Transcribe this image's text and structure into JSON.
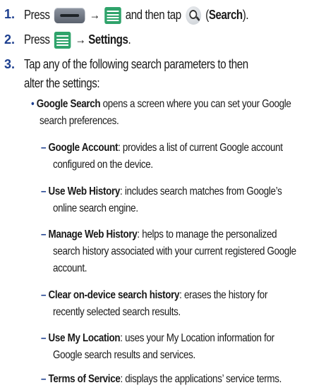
{
  "steps": [
    {
      "number": "1.",
      "press": "Press",
      "arrow": "→",
      "and_then_tap": "and then tap",
      "open_paren": "(",
      "search_label": "Search",
      "close_paren": ")."
    },
    {
      "number": "2.",
      "press": "Press",
      "arrow": "→",
      "settings_label": "Settings",
      "period": "."
    },
    {
      "number": "3.",
      "line1": "Tap any of the following search parameters to then",
      "line2": "alter the settings:"
    }
  ],
  "bullet": {
    "marker": "•",
    "term": "Google Search",
    "line1": "opens a screen where you can set your Google",
    "line2": "search preferences."
  },
  "items": [
    {
      "dash": "–",
      "term": "Google Account",
      "line1": ": provides a list of current Google account",
      "line2": "configured on the device."
    },
    {
      "dash": "–",
      "term": "Use Web History",
      "line1": ": includes search matches from Google’s",
      "line2": "online search engine."
    },
    {
      "dash": "–",
      "term": "Manage Web History",
      "line1": ": helps to manage the personalized",
      "line2": "search history associated with your current registered Google",
      "line3": "account."
    },
    {
      "dash": "–",
      "term": "Clear on-device search history",
      "line1": ": erases the history for",
      "line2": "recently selected search results."
    },
    {
      "dash": "–",
      "term": "Use My Location",
      "line1": ": uses your My Location information for",
      "line2": "Google search results and services."
    },
    {
      "dash": "–",
      "term": "Terms of Service",
      "line1": ": displays the applications’ service terms."
    }
  ],
  "icons": [
    "home-key-icon",
    "menu-key-icon",
    "search-icon"
  ]
}
